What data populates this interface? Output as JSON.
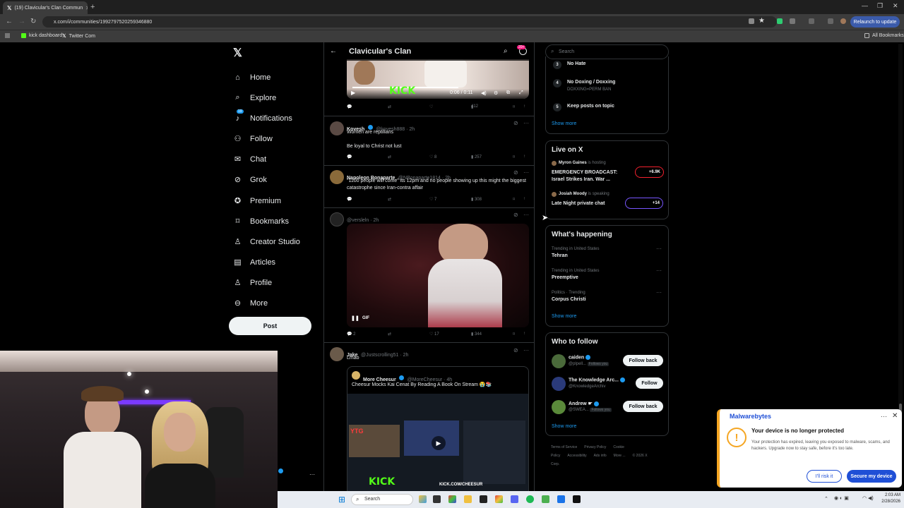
{
  "browser": {
    "tab_title": "(19) Clavicular's Clan Commun",
    "url": "x.com/i/communities/1992797520259346880",
    "relaunch_label": "Relaunch to update",
    "bookmarks": [
      "kick dashboard",
      "Twitter Com"
    ],
    "all_bookmarks": "All Bookmarks"
  },
  "sidebar": {
    "items": [
      {
        "label": "Home",
        "icon": "home-icon"
      },
      {
        "label": "Explore",
        "icon": "search-icon"
      },
      {
        "label": "Notifications",
        "icon": "bell-icon",
        "badge": "19"
      },
      {
        "label": "Follow",
        "icon": "add-person-icon"
      },
      {
        "label": "Chat",
        "icon": "mail-icon"
      },
      {
        "label": "Grok",
        "icon": "grok-icon"
      },
      {
        "label": "Premium",
        "icon": "premium-icon"
      },
      {
        "label": "Bookmarks",
        "icon": "bookmark-icon"
      },
      {
        "label": "Creator Studio",
        "icon": "studio-icon"
      },
      {
        "label": "Articles",
        "icon": "articles-icon"
      },
      {
        "label": "Profile",
        "icon": "person-icon"
      },
      {
        "label": "More",
        "icon": "more-circle-icon"
      }
    ],
    "post_label": "Post"
  },
  "header": {
    "title": "Clavicular's Clan",
    "badge": "20+"
  },
  "tweets": {
    "t0": {
      "video_time": "0:06 / 0:11",
      "kick_text": "KICK",
      "views": "412"
    },
    "t1": {
      "name": "Kovesh",
      "handle": "@kovesh888 · 2h",
      "line1": "Women are reptilians",
      "line2": "Be loyal to Christ not lust",
      "likes": "8",
      "views": "257"
    },
    "t2": {
      "name": "Napoleon Bonaparte",
      "handle": "@NBonaparte1814 · 2h",
      "text": "\"1100 people will come\" its 12pm and no people showing up this might the biggest catastrophe since Iran-contra affair",
      "likes": "7",
      "views": "308"
    },
    "t3": {
      "handle": "@versleln · 2h",
      "gif": "GIF",
      "replies": "2",
      "likes": "17",
      "views": "344"
    },
    "t4": {
      "name": "Jake",
      "handle": "@Justscrolling51 · 2h",
      "text": "Lmao",
      "quote_name": "More Cheesur",
      "quote_handle": "@MoreCheesur · 4h",
      "quote_text": "Cheesur Mocks Kai Cenat By Reading A Book On Stream 😭📚",
      "quote_kick": "KICK",
      "quote_kick_url": "KICK.COM/CHEESUR"
    }
  },
  "right": {
    "search_placeholder": "Search",
    "rules": [
      {
        "num": "3",
        "title": "No Hate",
        "sub": ""
      },
      {
        "num": "4",
        "title": "No Doxing / Doxxing",
        "sub": "DOXXING=PERM BAN"
      },
      {
        "num": "5",
        "title": "Keep posts on topic",
        "sub": ""
      }
    ],
    "show_more": "Show more",
    "live_title": "Live on X",
    "live": [
      {
        "host": "Myron Gaines",
        "status": "is hosting",
        "title": "EMERGENCY BROADCAST: Israel Strikes Iran. War ...",
        "count": "+6.9K"
      },
      {
        "host": "Josiah Moody",
        "status": "is speaking",
        "title": "Late Night private chat",
        "count": "+14"
      }
    ],
    "happening_title": "What's happening",
    "trends": [
      {
        "context": "Trending in United States",
        "topic": "Tehran"
      },
      {
        "context": "Trending in United States",
        "topic": "Preemptive"
      },
      {
        "context": "Politics · Trending",
        "topic": "Corpus Christi"
      }
    ],
    "wtf_title": "Who to follow",
    "follow": [
      {
        "name": "caiden",
        "handle": "@plpell...",
        "tag": "Follows you",
        "btn": "Follow back"
      },
      {
        "name": "The Knowledge Arc...",
        "handle": "@KnowledgeArchiv",
        "tag": "",
        "btn": "Follow"
      },
      {
        "name": "Andrew ☛",
        "handle": "@SWEA...",
        "tag": "Follows you",
        "btn": "Follow back"
      }
    ],
    "footer": [
      "Terms of Service",
      "Privacy Policy",
      "Cookie Policy",
      "Accessibility",
      "Ads info",
      "More ...",
      "© 2026 X Corp."
    ]
  },
  "malwarebytes": {
    "brand": "Malwarebytes",
    "title": "Your device is no longer protected",
    "body": "Your protection has expired, leaving you exposed to malware, scams, and hackers. Upgrade now to stay safe, before it's too late.",
    "risk_label": "I'll risk it",
    "secure_label": "Secure my device"
  },
  "taskbar": {
    "search": "Search",
    "time": "2:03 AM",
    "date": "2/28/2026"
  },
  "colors": {
    "accent": "#1d9bf0",
    "mb_blue": "#1f4fd6",
    "kick_green": "#53fc18"
  }
}
